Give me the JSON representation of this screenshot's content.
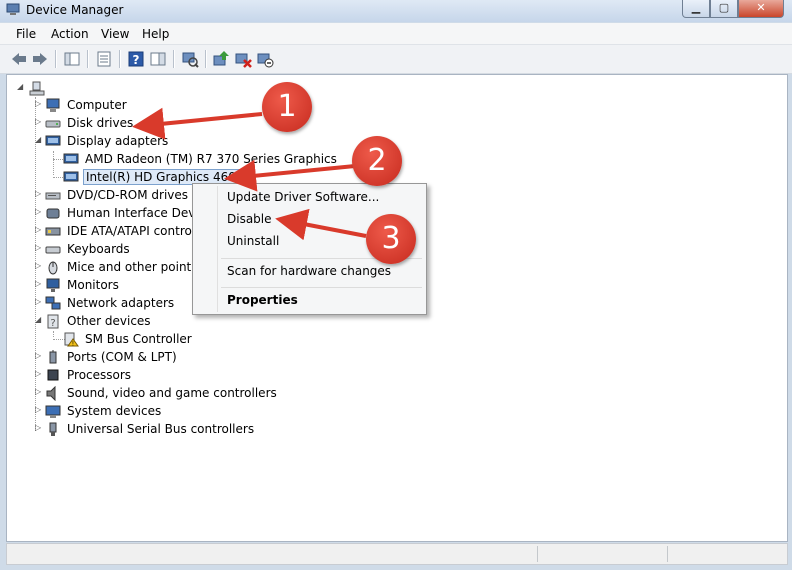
{
  "window": {
    "title": "Device Manager",
    "buttons": {
      "minimize": "▁",
      "maximize": "▢",
      "close": "✕"
    }
  },
  "menubar": {
    "items": [
      "File",
      "Action",
      "View",
      "Help"
    ]
  },
  "toolbar": {
    "icons": [
      "back-icon",
      "forward-icon",
      "show-hide-console-tree-icon",
      "properties-icon",
      "help-icon",
      "action-pane-icon",
      "scan-hardware-icon",
      "update-driver-icon",
      "uninstall-icon",
      "disable-icon"
    ]
  },
  "tree": {
    "root": "",
    "items": [
      {
        "label": "Computer",
        "icon": "computer-icon",
        "expanded": false
      },
      {
        "label": "Disk drives",
        "icon": "disk-drive-icon",
        "expanded": false
      },
      {
        "label": "Display adapters",
        "icon": "display-adapter-icon",
        "expanded": true,
        "children": [
          {
            "label": "AMD Radeon (TM) R7 370 Series Graphics",
            "icon": "display-adapter-icon"
          },
          {
            "label": "Intel(R) HD Graphics 4600",
            "icon": "display-adapter-icon",
            "selected": true
          }
        ]
      },
      {
        "label": "DVD/CD-ROM drives",
        "icon": "dvd-drive-icon",
        "expanded": false
      },
      {
        "label": "Human Interface Devic",
        "icon": "hid-icon",
        "expanded": false
      },
      {
        "label": "IDE ATA/ATAPI control",
        "icon": "ide-controller-icon",
        "expanded": false
      },
      {
        "label": "Keyboards",
        "icon": "keyboard-icon",
        "expanded": false
      },
      {
        "label": "Mice and other pointin",
        "icon": "mouse-icon",
        "expanded": false
      },
      {
        "label": "Monitors",
        "icon": "monitor-icon",
        "expanded": false
      },
      {
        "label": "Network adapters",
        "icon": "network-adapter-icon",
        "expanded": false
      },
      {
        "label": "Other devices",
        "icon": "other-devices-icon",
        "expanded": true,
        "children": [
          {
            "label": "SM Bus Controller",
            "icon": "unknown-device-warning-icon"
          }
        ]
      },
      {
        "label": "Ports (COM & LPT)",
        "icon": "port-icon",
        "expanded": false
      },
      {
        "label": "Processors",
        "icon": "processor-icon",
        "expanded": false
      },
      {
        "label": "Sound, video and game controllers",
        "icon": "sound-icon",
        "expanded": false
      },
      {
        "label": "System devices",
        "icon": "system-devices-icon",
        "expanded": false
      },
      {
        "label": "Universal Serial Bus controllers",
        "icon": "usb-icon",
        "expanded": false
      }
    ]
  },
  "context_menu": {
    "items": [
      {
        "label": "Update Driver Software..."
      },
      {
        "label": "Disable"
      },
      {
        "label": "Uninstall"
      },
      {
        "label": "Scan for hardware changes"
      },
      {
        "label": "Properties",
        "bold": true
      }
    ]
  },
  "callouts": [
    "1",
    "2",
    "3"
  ],
  "colors": {
    "callout": "#d93a2b",
    "selection_border": "#7da2ce",
    "selection_fill": "#dfeaf8"
  }
}
